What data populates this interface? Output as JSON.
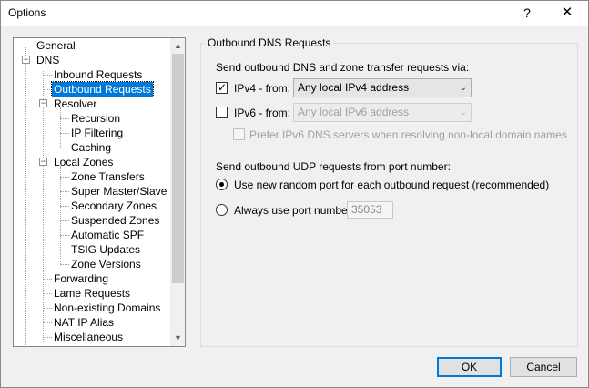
{
  "window": {
    "title": "Options",
    "help_glyph": "?",
    "close_glyph": "✕"
  },
  "tree": {
    "items": [
      {
        "label": "General"
      },
      {
        "label": "DNS",
        "expander": "−"
      },
      {
        "label": "Inbound Requests"
      },
      {
        "label": "Outbound Requests",
        "selected": true
      },
      {
        "label": "Resolver",
        "expander": "−"
      },
      {
        "label": "Recursion"
      },
      {
        "label": "IP Filtering"
      },
      {
        "label": "Caching"
      },
      {
        "label": "Local Zones",
        "expander": "−"
      },
      {
        "label": "Zone Transfers"
      },
      {
        "label": "Super Master/Slave"
      },
      {
        "label": "Secondary Zones"
      },
      {
        "label": "Suspended Zones"
      },
      {
        "label": "Automatic SPF"
      },
      {
        "label": "TSIG Updates"
      },
      {
        "label": "Zone Versions"
      },
      {
        "label": "Forwarding"
      },
      {
        "label": "Lame Requests"
      },
      {
        "label": "Non-existing Domains"
      },
      {
        "label": "NAT IP Alias"
      },
      {
        "label": "Miscellaneous"
      }
    ],
    "scroll_up_glyph": "▲",
    "scroll_down_glyph": "▼"
  },
  "group": {
    "title": "Outbound DNS Requests",
    "send_via_label": "Send outbound DNS and zone transfer requests via:",
    "ipv4": {
      "label": "IPv4 - from:",
      "checked": true,
      "value": "Any local IPv4 address"
    },
    "ipv6": {
      "label": "IPv6 - from:",
      "checked": false,
      "value": "Any local IPv6 address"
    },
    "prefer_ipv6_label": "Prefer IPv6 DNS servers when resolving non-local domain names",
    "udp_label": "Send outbound UDP requests from port number:",
    "random_port_label": "Use new random port for each outbound request (recommended)",
    "always_port_label": "Always use port number:",
    "port_value": "35053",
    "check_glyph": "✓",
    "dropdown_glyph": "⌄"
  },
  "buttons": {
    "ok": "OK",
    "cancel": "Cancel"
  }
}
